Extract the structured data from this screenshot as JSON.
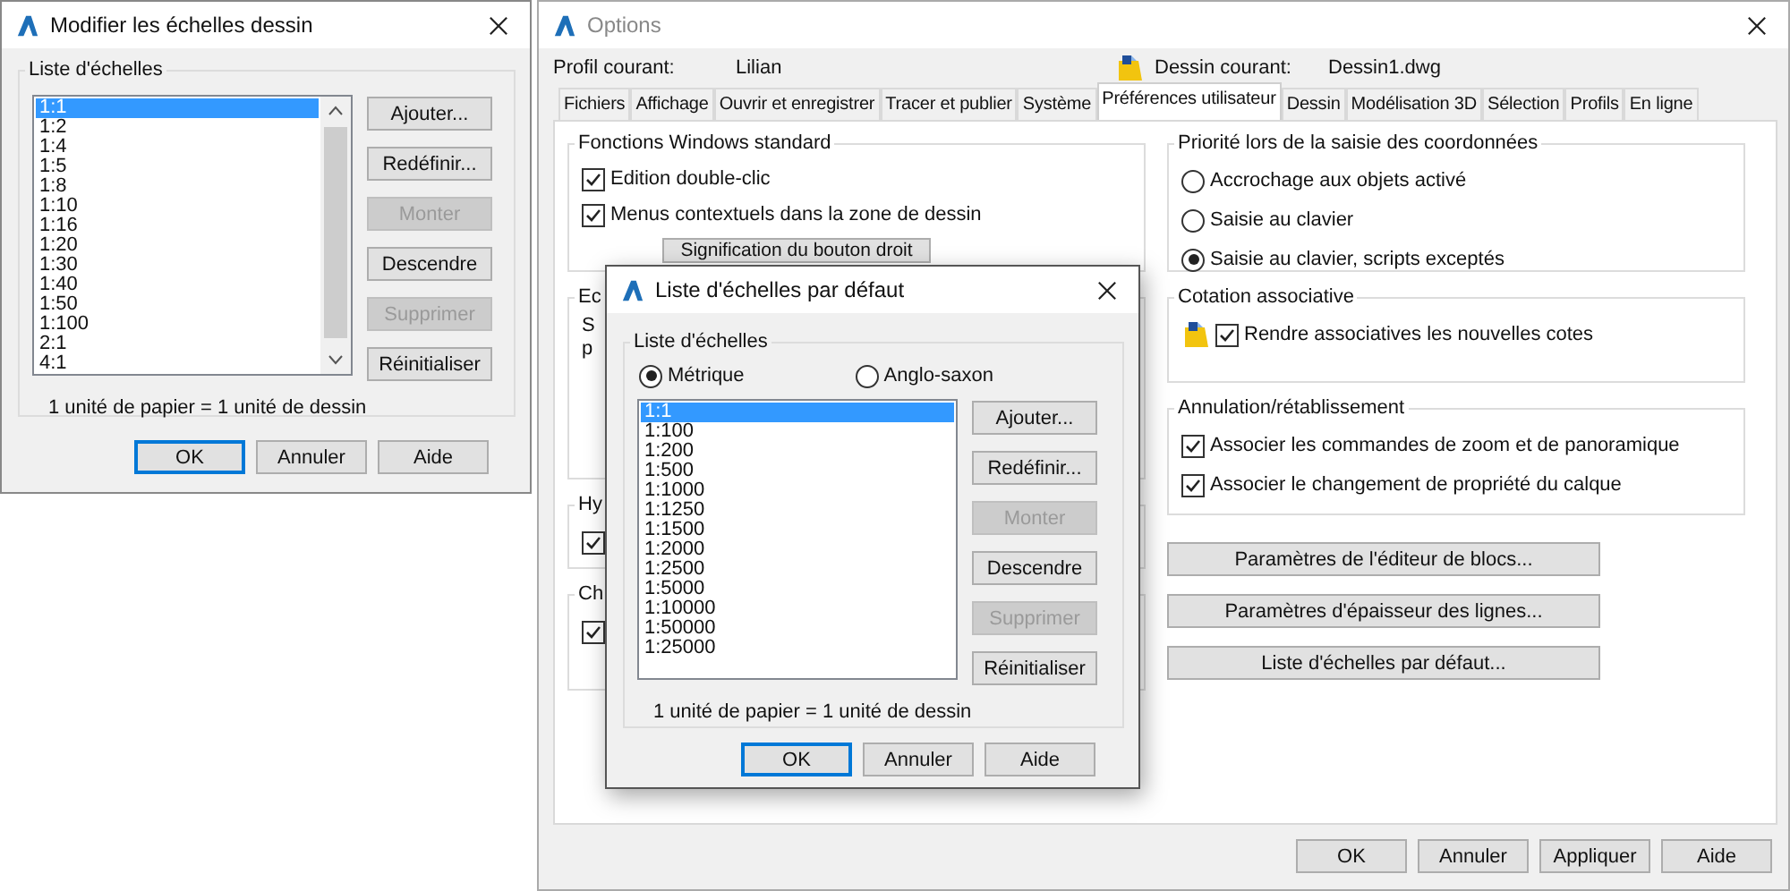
{
  "scale_dialog": {
    "title": "Modifier les échelles dessin",
    "group_title": "Liste d'échelles",
    "items": [
      {
        "label": "1:1",
        "selected": true
      },
      {
        "label": "1:2",
        "selected": false
      },
      {
        "label": "1:4",
        "selected": false
      },
      {
        "label": "1:5",
        "selected": false
      },
      {
        "label": "1:8",
        "selected": false
      },
      {
        "label": "1:10",
        "selected": false
      },
      {
        "label": "1:16",
        "selected": false
      },
      {
        "label": "1:20",
        "selected": false
      },
      {
        "label": "1:30",
        "selected": false
      },
      {
        "label": "1:40",
        "selected": false
      },
      {
        "label": "1:50",
        "selected": false
      },
      {
        "label": "1:100",
        "selected": false
      },
      {
        "label": "2:1",
        "selected": false
      },
      {
        "label": "4:1",
        "selected": false
      }
    ],
    "buttons": [
      {
        "label": "Ajouter...",
        "disabled": false
      },
      {
        "label": "Redéfinir...",
        "disabled": false
      },
      {
        "label": "Monter",
        "disabled": true
      },
      {
        "label": "Descendre",
        "disabled": false
      },
      {
        "label": "Supprimer",
        "disabled": true
      },
      {
        "label": "Réinitialiser",
        "disabled": false
      }
    ],
    "note": "1 unité de papier = 1 unité de dessin",
    "footer_buttons": [
      {
        "label": "OK",
        "default": true
      },
      {
        "label": "Annuler",
        "default": false
      },
      {
        "label": "Aide",
        "default": false
      }
    ]
  },
  "options": {
    "title": "Options",
    "profile_label": "Profil courant:",
    "profile_value": "Lilian",
    "drawing_label": "Dessin courant:",
    "drawing_value": "Dessin1.dwg",
    "tabs": [
      {
        "label": "Fichiers",
        "selected": false
      },
      {
        "label": "Affichage",
        "selected": false
      },
      {
        "label": "Ouvrir et enregistrer",
        "selected": false
      },
      {
        "label": "Tracer et publier",
        "selected": false
      },
      {
        "label": "Système",
        "selected": false
      },
      {
        "label": "Préférences utilisateur",
        "selected": true
      },
      {
        "label": "Dessin",
        "selected": false
      },
      {
        "label": "Modélisation 3D",
        "selected": false
      },
      {
        "label": "Sélection",
        "selected": false
      },
      {
        "label": "Profils",
        "selected": false
      },
      {
        "label": "En ligne",
        "selected": false
      }
    ],
    "windows_group": {
      "title": "Fonctions Windows standard",
      "options": [
        {
          "label": "Edition double-clic",
          "checked": true
        },
        {
          "label": "Menus contextuels dans la zone de dessin",
          "checked": true
        }
      ],
      "button": "Signification du bouton droit"
    },
    "partial_groups": [
      {
        "title": "Ec",
        "lines": [
          "S",
          "p"
        ]
      },
      {
        "title": "Hy",
        "options": [
          {
            "checked": true
          }
        ]
      },
      {
        "title": "Ch",
        "options": [
          {
            "checked": true
          }
        ]
      }
    ],
    "coord_group": {
      "title": "Priorité lors de la saisie des coordonnées",
      "options": [
        {
          "label": "Accrochage aux objets activé",
          "selected": false
        },
        {
          "label": "Saisie au clavier",
          "selected": false
        },
        {
          "label": "Saisie au clavier, scripts exceptés",
          "selected": true
        }
      ]
    },
    "assoc_group": {
      "title": "Cotation associative",
      "options": [
        {
          "label": "Rendre associatives les nouvelles cotes",
          "checked": true
        }
      ]
    },
    "undo_group": {
      "title": "Annulation/rétablissement",
      "options": [
        {
          "label": "Associer les commandes de zoom et de panoramique",
          "checked": true
        },
        {
          "label": "Associer le changement de propriété du calque",
          "checked": true
        }
      ]
    },
    "buttons": [
      "Paramètres de l'éditeur de blocs...",
      "Paramètres d'épaisseur des lignes...",
      "Liste d'échelles par défaut..."
    ],
    "footer_buttons": [
      {
        "label": "OK",
        "default": false
      },
      {
        "label": "Annuler",
        "default": false
      },
      {
        "label": "Appliquer",
        "default": false
      },
      {
        "label": "Aide",
        "default": false
      }
    ]
  },
  "default_scale_dialog": {
    "title": "Liste d'échelles par défaut",
    "group_title": "Liste d'échelles",
    "units": [
      {
        "label": "Métrique",
        "selected": true
      },
      {
        "label": "Anglo-saxon",
        "selected": false
      }
    ],
    "items": [
      {
        "label": "1:1",
        "selected": true
      },
      {
        "label": "1:100",
        "selected": false
      },
      {
        "label": "1:200",
        "selected": false
      },
      {
        "label": "1:500",
        "selected": false
      },
      {
        "label": "1:1000",
        "selected": false
      },
      {
        "label": "1:1250",
        "selected": false
      },
      {
        "label": "1:1500",
        "selected": false
      },
      {
        "label": "1:2000",
        "selected": false
      },
      {
        "label": "1:2500",
        "selected": false
      },
      {
        "label": "1:5000",
        "selected": false
      },
      {
        "label": "1:10000",
        "selected": false
      },
      {
        "label": "1:50000",
        "selected": false
      },
      {
        "label": "1:25000",
        "selected": false
      }
    ],
    "buttons": [
      {
        "label": "Ajouter...",
        "disabled": false
      },
      {
        "label": "Redéfinir...",
        "disabled": false
      },
      {
        "label": "Monter",
        "disabled": true
      },
      {
        "label": "Descendre",
        "disabled": false
      },
      {
        "label": "Supprimer",
        "disabled": true
      },
      {
        "label": "Réinitialiser",
        "disabled": false
      }
    ],
    "note": "1 unité de papier = 1 unité de dessin",
    "footer_buttons": [
      {
        "label": "OK",
        "default": true
      },
      {
        "label": "Annuler",
        "default": false
      },
      {
        "label": "Aide",
        "default": false
      }
    ]
  }
}
